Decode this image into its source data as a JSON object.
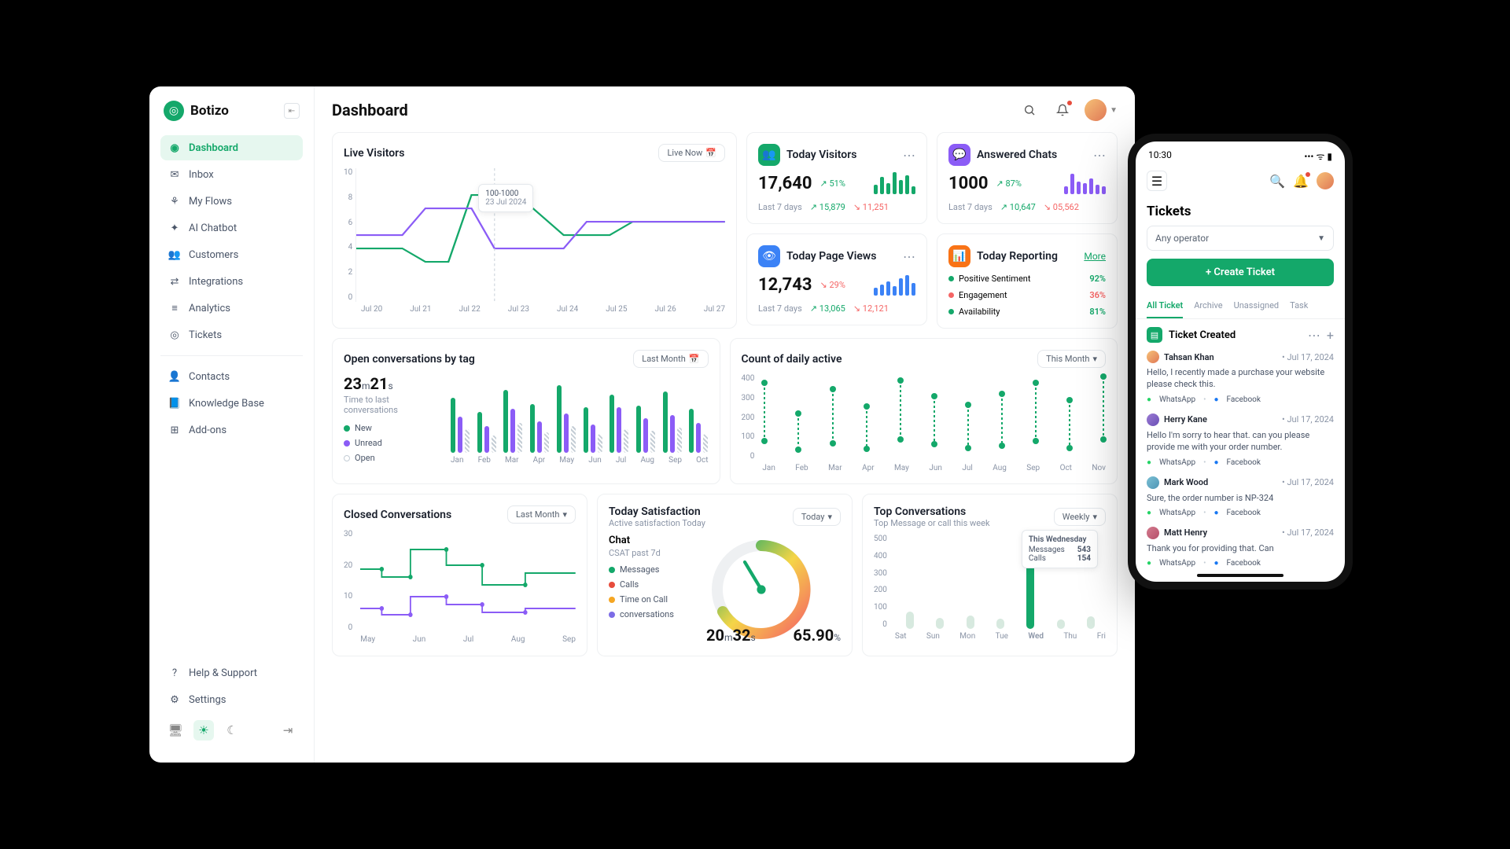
{
  "brand": "Botizo",
  "pageTitle": "Dashboard",
  "nav": {
    "main": [
      "Dashboard",
      "Inbox",
      "My Flows",
      "AI Chatbot",
      "Customers",
      "Integrations",
      "Analytics",
      "Tickets"
    ],
    "secondary": [
      "Contacts",
      "Knowledge Base",
      "Add-ons"
    ],
    "bottom": [
      "Help & Support",
      "Settings"
    ]
  },
  "liveVisitors": {
    "title": "Live Visitors",
    "chip": "Live Now",
    "yticks": [
      "10",
      "8",
      "6",
      "4",
      "2",
      "0"
    ],
    "xticks": [
      "Jul 20",
      "Jul 21",
      "Jul 22",
      "Jul 23",
      "Jul 24",
      "Jul 25",
      "Jul 26",
      "Jul 27"
    ],
    "tooltip": {
      "range": "100-1000",
      "date": "23 Jul 2024"
    }
  },
  "todayVisitors": {
    "title": "Today Visitors",
    "value": "17,640",
    "pct": "51%",
    "last7": "Last 7 days",
    "a": "15,879",
    "b": "11,251"
  },
  "answeredChats": {
    "title": "Answered Chats",
    "value": "1000",
    "pct": "87%",
    "last7": "Last 7 days",
    "a": "10,647",
    "b": "05,562"
  },
  "pageViews": {
    "title": "Today Page Views",
    "value": "12,743",
    "pct": "29%",
    "last7": "Last 7 days",
    "a": "13,065",
    "b": "12,121"
  },
  "reporting": {
    "title": "Today Reporting",
    "more": "More",
    "rows": [
      {
        "l": "Positive Sentiment",
        "v": "92%",
        "c": "#14a86a"
      },
      {
        "l": "Engagement",
        "v": "36%",
        "c": "#f56565"
      },
      {
        "l": "Availability",
        "v": "81%",
        "c": "#14a86a"
      }
    ]
  },
  "openConv": {
    "title": "Open conversations by tag",
    "chip": "Last Month",
    "time": {
      "m": "23",
      "s": "21"
    },
    "sub": "Time to last conversations",
    "legend": [
      "New",
      "Unread",
      "Open"
    ],
    "months": [
      "Jan",
      "Feb",
      "Mar",
      "Apr",
      "May",
      "Jun",
      "Jul",
      "Aug",
      "Sep",
      "Oct"
    ]
  },
  "dailyActive": {
    "title": "Count of daily active",
    "chip": "This Month",
    "yticks": [
      "400",
      "300",
      "200",
      "100",
      "0"
    ],
    "months": [
      "Jan",
      "Feb",
      "Mar",
      "Apr",
      "May",
      "Jun",
      "Jul",
      "Aug",
      "Sep",
      "Oct",
      "Nov"
    ]
  },
  "closedConv": {
    "title": "Closed Conversations",
    "chip": "Last Month",
    "yticks": [
      "30",
      "20",
      "10",
      "0"
    ],
    "months": [
      "May",
      "Jun",
      "Jul",
      "Aug",
      "Sep"
    ]
  },
  "satisfaction": {
    "title": "Today Satisfaction",
    "sub": "Active satisfaction Today",
    "chip": "Today",
    "chat": "Chat",
    "csat": "CSAT past 7d",
    "legend": [
      "Messages",
      "Calls",
      "Time on Call",
      "conversations"
    ],
    "colors": [
      "#14a86a",
      "#e74c3c",
      "#f5a623",
      "#7c6ce6"
    ],
    "timeM": "20",
    "timeS": "32",
    "pct": "65.90"
  },
  "topConv": {
    "title": "Top Conversations",
    "sub": "Top Message or call this week",
    "chip": "Weekly",
    "yticks": [
      "500",
      "400",
      "300",
      "200",
      "100",
      "0"
    ],
    "days": [
      "Sat",
      "Sun",
      "Mon",
      "Tue",
      "Wed",
      "Thu",
      "Fri"
    ],
    "tooltip": {
      "title": "This Wednesday",
      "l1": "Messages",
      "v1": "543",
      "l2": "Calls",
      "v2": "154"
    }
  },
  "chart_data": [
    {
      "type": "line",
      "title": "Live Visitors",
      "x": [
        "Jul 20",
        "Jul 21",
        "Jul 22",
        "Jul 23",
        "Jul 24",
        "Jul 25",
        "Jul 26",
        "Jul 27"
      ],
      "ylim": [
        0,
        10
      ],
      "series": [
        {
          "name": "green",
          "values": [
            4,
            4,
            3,
            8,
            8,
            5,
            5,
            6
          ]
        },
        {
          "name": "purple",
          "values": [
            5,
            5,
            7,
            7,
            4,
            4,
            6,
            6
          ]
        }
      ],
      "annotation": {
        "x": "Jul 23",
        "range": "100-1000",
        "date": "23 Jul 2024"
      }
    },
    {
      "type": "bar",
      "title": "Today Visitors minibars",
      "categories": [
        1,
        2,
        3,
        4,
        5,
        6,
        7
      ],
      "values": [
        12,
        22,
        14,
        28,
        18,
        24,
        10
      ],
      "color": "#14a86a"
    },
    {
      "type": "bar",
      "title": "Answered Chats minibars",
      "categories": [
        1,
        2,
        3,
        4,
        5,
        6,
        7
      ],
      "values": [
        10,
        26,
        16,
        14,
        20,
        12,
        10
      ],
      "color": "#8b5cf6"
    },
    {
      "type": "bar",
      "title": "Today Page Views minibars",
      "categories": [
        1,
        2,
        3,
        4,
        5,
        6,
        7
      ],
      "values": [
        10,
        14,
        18,
        12,
        22,
        26,
        16
      ],
      "color": "#3b82f6"
    },
    {
      "type": "bar",
      "title": "Open conversations by tag",
      "categories": [
        "Jan",
        "Feb",
        "Mar",
        "Apr",
        "May",
        "Jun",
        "Jul",
        "Aug",
        "Sep",
        "Oct"
      ],
      "series": [
        {
          "name": "New",
          "values": [
            70,
            52,
            80,
            62,
            86,
            58,
            74,
            60,
            78,
            56
          ]
        },
        {
          "name": "Unread",
          "values": [
            46,
            34,
            56,
            40,
            50,
            36,
            58,
            44,
            48,
            38
          ]
        },
        {
          "name": "Open",
          "values": [
            30,
            22,
            38,
            26,
            34,
            24,
            30,
            28,
            32,
            24
          ]
        }
      ]
    },
    {
      "type": "scatter",
      "title": "Count of daily active",
      "x": [
        "Jan",
        "Feb",
        "Mar",
        "Apr",
        "May",
        "Jun",
        "Jul",
        "Aug",
        "Sep",
        "Oct",
        "Nov"
      ],
      "ylim": [
        0,
        400
      ],
      "series": [
        {
          "name": "low",
          "values": [
            90,
            50,
            80,
            55,
            100,
            75,
            60,
            70,
            90,
            60,
            100
          ]
        },
        {
          "name": "high",
          "values": [
            360,
            220,
            330,
            250,
            370,
            300,
            260,
            310,
            360,
            280,
            390
          ]
        }
      ]
    },
    {
      "type": "line",
      "title": "Closed Conversations",
      "x": [
        "May",
        "Jun",
        "Jul",
        "Aug",
        "Sep"
      ],
      "ylim": [
        0,
        30
      ],
      "series": [
        {
          "name": "green",
          "values": [
            20,
            18,
            28,
            22,
            16
          ]
        },
        {
          "name": "purple",
          "values": [
            8,
            6,
            12,
            9,
            7
          ]
        }
      ]
    },
    {
      "type": "pie",
      "title": "Today Satisfaction",
      "values": [
        65.9,
        34.1
      ],
      "labels": [
        "satisfied",
        "other"
      ]
    },
    {
      "type": "bar",
      "title": "Top Conversations",
      "categories": [
        "Sat",
        "Sun",
        "Mon",
        "Tue",
        "Wed",
        "Thu",
        "Fri"
      ],
      "ylim": [
        0,
        500
      ],
      "values": [
        90,
        60,
        70,
        55,
        480,
        50,
        65
      ],
      "highlight": "Wed"
    }
  ],
  "mobile": {
    "time": "10:30",
    "title": "Tickets",
    "operator": "Any operator",
    "createBtn": "+  Create Ticket",
    "tabs": [
      "All Ticket",
      "Archive",
      "Unassigned",
      "Task"
    ],
    "sectionTitle": "Ticket Created",
    "tickets": [
      {
        "name": "Tahsan Khan",
        "date": "Jul 17, 2024",
        "body": "Hello, I recently made a purchase your website please check this.",
        "av": "linear-gradient(135deg,#f6c177,#e07856)"
      },
      {
        "name": "Herry Kane",
        "date": "Jul 17, 2024",
        "body": "Hello I'm sorry to hear that. can you please provide me with your order number.",
        "av": "linear-gradient(135deg,#9b7bd4,#6a4fb5)"
      },
      {
        "name": "Mark Wood",
        "date": "Jul 17, 2024",
        "body": "Sure, the order number is NP-324",
        "av": "linear-gradient(135deg,#7bc0d4,#4f95b5)"
      },
      {
        "name": "Matt Henry",
        "date": "Jul 17, 2024",
        "body": "Thank you for providing that. Can",
        "av": "linear-gradient(135deg,#d47b8e,#b54f6a)"
      }
    ],
    "channels": {
      "w": "WhatsApp",
      "f": "Facebook"
    }
  }
}
